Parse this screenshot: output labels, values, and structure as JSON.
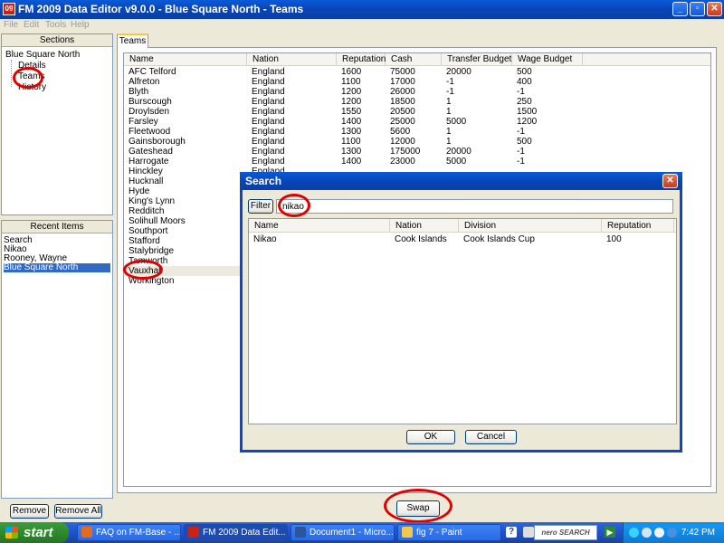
{
  "window": {
    "title": "FM 2009 Data Editor v9.0.0 - Blue Square North - Teams",
    "app_icon_text": "09"
  },
  "menu": [
    "File",
    "Edit",
    "Tools",
    "Help"
  ],
  "sections_panel": {
    "header": "Sections",
    "root": "Blue Square North",
    "children": [
      "Details",
      "Teams",
      "History"
    ]
  },
  "recent_panel": {
    "header": "Recent Items",
    "items": [
      "Search",
      "Nikao",
      "Rooney, Wayne",
      "Blue Square North"
    ],
    "selected_index": 3,
    "remove_label": "Remove",
    "remove_all_label": "Remove All"
  },
  "teams_tab": {
    "label": "Teams",
    "columns": [
      "Name",
      "Nation",
      "Reputation",
      "Cash",
      "Transfer Budget",
      "Wage Budget"
    ],
    "rows": [
      [
        "AFC Telford",
        "England",
        "1600",
        "75000",
        "20000",
        "500"
      ],
      [
        "Alfreton",
        "England",
        "1100",
        "17000",
        "-1",
        "400"
      ],
      [
        "Blyth",
        "England",
        "1200",
        "26000",
        "-1",
        "-1"
      ],
      [
        "Burscough",
        "England",
        "1200",
        "18500",
        "1",
        "250"
      ],
      [
        "Droylsden",
        "England",
        "1550",
        "20500",
        "1",
        "1500"
      ],
      [
        "Farsley",
        "England",
        "1400",
        "25000",
        "5000",
        "1200"
      ],
      [
        "Fleetwood",
        "England",
        "1300",
        "5600",
        "1",
        "-1"
      ],
      [
        "Gainsborough",
        "England",
        "1100",
        "12000",
        "1",
        "500"
      ],
      [
        "Gateshead",
        "England",
        "1300",
        "175000",
        "20000",
        "-1"
      ],
      [
        "Harrogate",
        "England",
        "1400",
        "23000",
        "5000",
        "-1"
      ],
      [
        "Hinckley",
        "England",
        "",
        "",
        "",
        ""
      ],
      [
        "Hucknall",
        "",
        "",
        "",
        "",
        ""
      ],
      [
        "Hyde",
        "",
        "",
        "",
        "",
        ""
      ],
      [
        "King's Lynn",
        "",
        "",
        "",
        "",
        ""
      ],
      [
        "Redditch",
        "",
        "",
        "",
        "",
        ""
      ],
      [
        "Solihull Moors",
        "",
        "",
        "",
        "",
        ""
      ],
      [
        "Southport",
        "",
        "",
        "",
        "",
        ""
      ],
      [
        "Stafford",
        "",
        "",
        "",
        "",
        ""
      ],
      [
        "Stalybridge",
        "",
        "",
        "",
        "",
        ""
      ],
      [
        "Tamworth",
        "",
        "",
        "",
        "",
        ""
      ],
      [
        "Vauxhall",
        "",
        "",
        "",
        "",
        ""
      ],
      [
        "Workington",
        "",
        "",
        "",
        "",
        ""
      ]
    ],
    "selected_row": 20,
    "swap_label": "Swap"
  },
  "search_dialog": {
    "title": "Search",
    "filter_label": "Filter",
    "filter_value": "nikao",
    "columns": [
      "Name",
      "Nation",
      "Division",
      "Reputation"
    ],
    "results": [
      [
        "Nikao",
        "Cook Islands",
        "Cook Islands Cup",
        "100"
      ]
    ],
    "ok_label": "OK",
    "cancel_label": "Cancel"
  },
  "taskbar": {
    "start_label": "start",
    "tasks": [
      "FAQ on FM-Base - ...",
      "FM 2009 Data Edit...",
      "Document1 - Micro...",
      "fig 7 - Paint"
    ],
    "active_task": 1,
    "search_widget": "nero SEARCH",
    "clock": "7:42 PM"
  },
  "annotation_color": "#e00000"
}
